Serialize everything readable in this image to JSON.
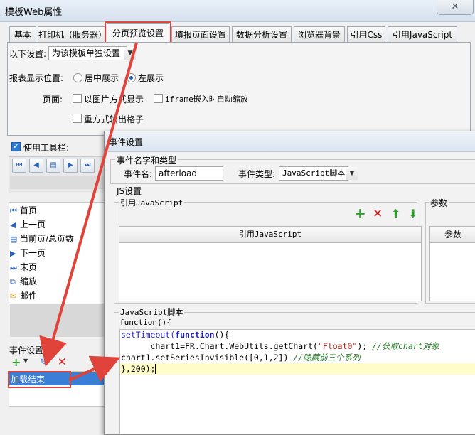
{
  "window": {
    "title": "模板Web属性",
    "close": "✕"
  },
  "tabs": [
    "基本",
    "打印机（服务器）",
    "分页预览设置",
    "填报页面设置",
    "数据分析设置",
    "浏览器背景",
    "引用Css",
    "引用JavaScript"
  ],
  "settings": {
    "following_label": "以下设置:",
    "following_value": "为该模板单独设置",
    "position_label": "报表显示位置:",
    "center_label": "居中展示",
    "left_label": "左展示",
    "page_label": "页面:",
    "image_mode_label": "以图片方式显示",
    "iframe_label": "iframe嵌入时自动缩放",
    "repeat_grid_label": "重方式输出格子",
    "use_toolbar_label": "使用工具栏:"
  },
  "toolbar_items": [
    {
      "icon": "first-page-icon",
      "glyph": "⏮",
      "label": "首页"
    },
    {
      "icon": "prev-page-icon",
      "glyph": "◀",
      "label": "上一页"
    },
    {
      "icon": "page-count-icon",
      "glyph": "▤",
      "label": "当前页/总页数"
    },
    {
      "icon": "next-page-icon",
      "glyph": "▶",
      "label": "下一页"
    },
    {
      "icon": "last-page-icon",
      "glyph": "⏭",
      "label": "末页"
    },
    {
      "icon": "zoom-icon",
      "glyph": "⧉",
      "label": "缩放"
    },
    {
      "icon": "mail-icon",
      "glyph": "✉",
      "label": "邮件"
    }
  ],
  "events": {
    "label": "事件设置",
    "selected": "加载结束"
  },
  "dialog": {
    "title": "事件设置",
    "name_group": "事件名字和类型",
    "name_label": "事件名:",
    "name_value": "afterload",
    "type_label": "事件类型:",
    "type_value": "JavaScript脚本",
    "js_group": "JS设置",
    "ref_group": "引用JavaScript",
    "param_group": "参数",
    "ref_col": "引用JavaScript",
    "param_col": "参数",
    "script_group": "JavaScript脚本",
    "fn_header": "function(){",
    "code": {
      "l1_kw": "setTimeout(",
      "l1_fn": "function",
      "l1_rest": "(){",
      "l2_a": "      chart1=FR.Chart.WebUtils.getChart(",
      "l2_str": "\"Float0\"",
      "l2_b": "); ",
      "l2_cm": "//获取chart对象",
      "l3_a": "chart1.setSeriesInvisible([0,1,2]) ",
      "l3_cm": "//隐藏前三个系列",
      "l4": "},200);"
    }
  },
  "colors": {
    "annotation_red": "#e0433a",
    "selection_blue": "#3a7fd5",
    "current_line": "#fffcc8"
  }
}
